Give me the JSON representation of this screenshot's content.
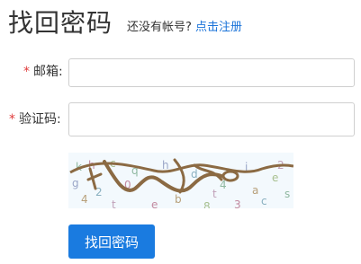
{
  "header": {
    "title": "找回密码",
    "prompt": "还没有帐号?",
    "register_link": "点击注册"
  },
  "form": {
    "required_mark": "*",
    "email_label": "邮箱:",
    "email_value": "",
    "code_label": "验证码:",
    "code_value": "",
    "captcha_noise": [
      "k",
      "h",
      "g",
      "4",
      "2",
      "c",
      "t",
      "q",
      "e",
      "h",
      "b",
      "d",
      "8",
      "t",
      "4",
      "3",
      "j",
      "a",
      "c",
      "e",
      "2",
      "s",
      "0"
    ],
    "submit_label": "找回密码"
  },
  "colors": {
    "accent": "#1a7be0",
    "link": "#1a73d9",
    "required": "#e03c3c",
    "captcha_stroke": "#8b6a43"
  }
}
